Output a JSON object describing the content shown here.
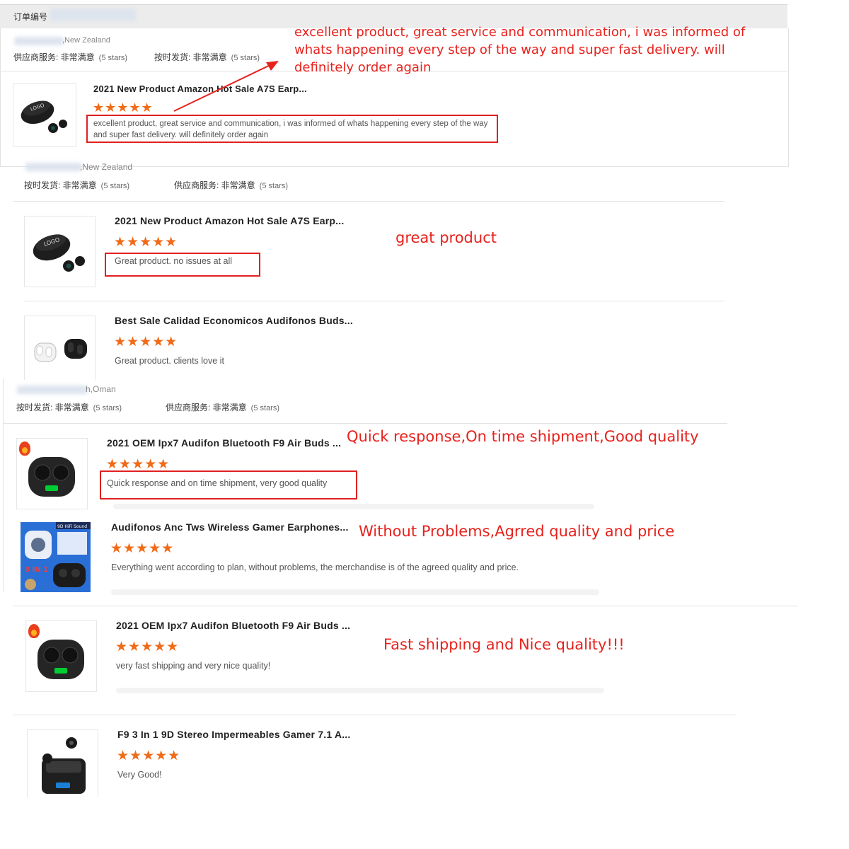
{
  "header": {
    "order_label": "订单编号"
  },
  "reviews": [
    {
      "country": ",New Zealand",
      "meta1_label": "供应商服务: 非常满意",
      "meta1_stars": "(5 stars)",
      "meta2_label": "按时发货: 非常满意",
      "meta2_stars": "(5 stars)",
      "product": "2021 New Product Amazon Hot Sale A7S Earp...",
      "rating": 5,
      "text": "excellent product, great service and communication, i was informed of whats happening every step of the way and super fast delivery. will definitely order again",
      "annotation": "excellent product, great service and communication, i was informed of whats happening every step of the way and super fast delivery. will definitely order again"
    },
    {
      "country": ",New Zealand",
      "meta1_label": "按时发货: 非常满意",
      "meta1_stars": "(5 stars)",
      "meta2_label": "供应商服务: 非常满意",
      "meta2_stars": "(5 stars)",
      "product": "2021 New Product Amazon Hot Sale A7S Earp...",
      "rating": 5,
      "text": "Great product. no issues at all",
      "annotation": "great product"
    },
    {
      "product": "Best Sale Calidad Economicos Audifonos Buds...",
      "rating": 5,
      "text": "Great product. clients love it"
    },
    {
      "country": "h,Oman",
      "meta1_label": "按时发货: 非常满意",
      "meta1_stars": "(5 stars)",
      "meta2_label": "供应商服务: 非常满意",
      "meta2_stars": "(5 stars)",
      "product": "2021 OEM Ipx7 Audifon Bluetooth F9 Air Buds ...",
      "rating": 5,
      "text": "Quick response and on time shipment, very good quality",
      "annotation": "Quick response,On time shipment,Good quality"
    },
    {
      "product": "Audifonos Anc Tws Wireless Gamer Earphones...",
      "rating": 5,
      "text": "Everything went according to plan, without problems, the merchandise is of the agreed quality and price.",
      "annotation": "Without Problems,Agrred quality and price",
      "thumb_text": [
        "9D HiFi Sound",
        "3 IN 1"
      ]
    },
    {
      "product": "2021 OEM Ipx7 Audifon Bluetooth F9 Air Buds ...",
      "rating": 5,
      "text": "very fast shipping and very nice quality!",
      "annotation": "Fast shipping and Nice quality!!!"
    },
    {
      "product": "F9 3 In 1 9D Stereo Impermeables Gamer 7.1 A...",
      "rating": 5,
      "text": "Very Good!"
    }
  ],
  "star_glyph": "★★★★★",
  "logo_text": "LOGO",
  "colors": {
    "star": "#f06a17",
    "annotation_red": "#e8211c",
    "box_red": "#e02020"
  }
}
